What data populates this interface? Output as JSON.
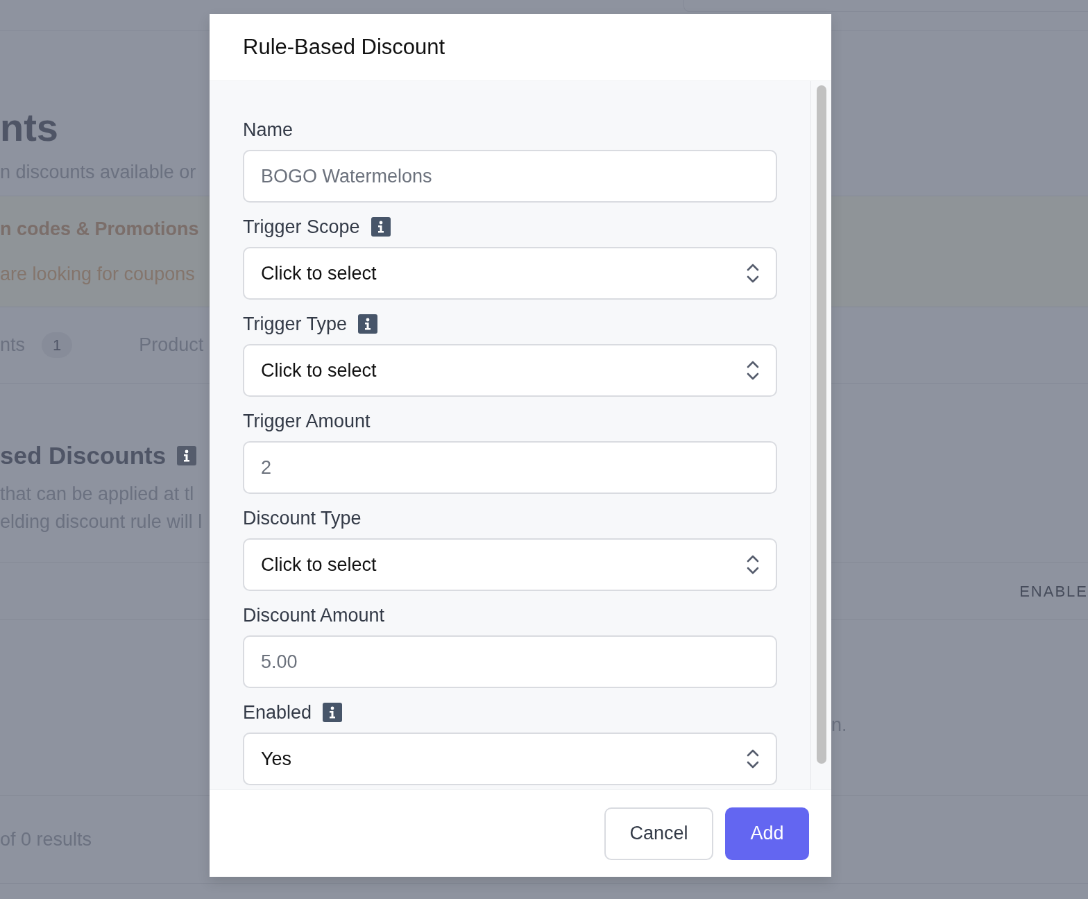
{
  "background": {
    "title": "nts",
    "subtitle": "n discounts available or",
    "promo": {
      "title": "n codes & Promotions",
      "text": "are looking for coupons"
    },
    "tabs": [
      {
        "label": "nts",
        "count": "1"
      },
      {
        "label": "Product"
      }
    ],
    "section": {
      "title": "sed Discounts",
      "info": true,
      "lines": [
        "that can be applied at tl",
        "elding discount rule will l"
      ]
    },
    "table": {
      "column_header": "ENABLE",
      "note": "n."
    },
    "footer": "of 0 results"
  },
  "modal": {
    "title": "Rule-Based Discount",
    "fields": [
      {
        "kind": "text",
        "label": "Name",
        "info": false,
        "placeholder": "BOGO Watermelons"
      },
      {
        "kind": "select",
        "label": "Trigger Scope",
        "info": true,
        "value": "Click to select"
      },
      {
        "kind": "select",
        "label": "Trigger Type",
        "info": true,
        "value": "Click to select"
      },
      {
        "kind": "text",
        "label": "Trigger Amount",
        "info": false,
        "placeholder": "2"
      },
      {
        "kind": "select",
        "label": "Discount Type",
        "info": false,
        "value": "Click to select"
      },
      {
        "kind": "text",
        "label": "Discount Amount",
        "info": false,
        "placeholder": "5.00"
      },
      {
        "kind": "select",
        "label": "Enabled",
        "info": true,
        "value": "Yes"
      }
    ],
    "buttons": [
      {
        "label": "Cancel",
        "kind": "secondary"
      },
      {
        "label": "Add",
        "kind": "primary"
      }
    ]
  }
}
